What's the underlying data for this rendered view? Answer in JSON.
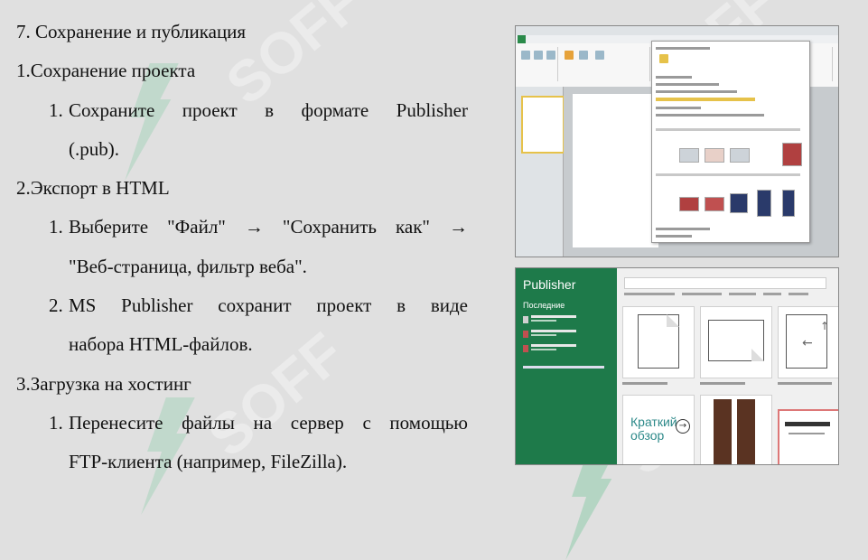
{
  "heading": "7. Сохранение и публикация",
  "sections": [
    {
      "title": "1.Сохранение проекта",
      "items": [
        {
          "num": "1.",
          "line1": "Сохраните проект в формате Publisher",
          "line2": "(.pub)."
        }
      ]
    },
    {
      "title": "2.Экспорт в HTML",
      "items": [
        {
          "num": "1.",
          "line1": "Выберите \"Файл\" → \"Сохранить как\" →",
          "line2": "\"Веб-страница, фильтр веба\"."
        },
        {
          "num": "2.",
          "line1": "MS Publisher сохранит проект в виде",
          "line2": "набора HTML-файлов."
        }
      ]
    },
    {
      "title": "3.Загрузка на хостинг",
      "items": [
        {
          "num": "1.",
          "line1": "Перенесите файлы на сервер с помощью",
          "line2": "FTP-клиента (например, FileZilla)."
        }
      ]
    }
  ],
  "screenshot_publisher": {
    "app_name": "Publisher",
    "recent_label": "Последние",
    "brief_label": "Краткий\nобзор",
    "accent_color": "#1e7a4a"
  },
  "watermark_text": "SOFF",
  "colors": {
    "background": "#e0e0e0",
    "text": "#111111",
    "watermark": "#3ea86b"
  }
}
